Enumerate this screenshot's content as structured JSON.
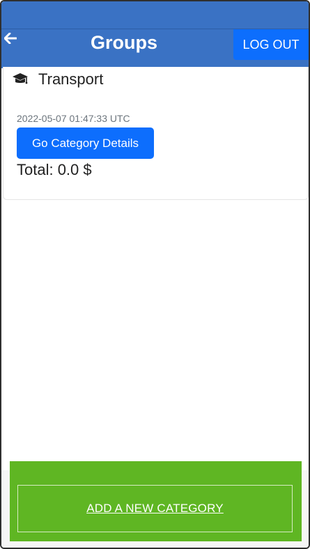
{
  "header": {
    "title": "Groups",
    "back_icon": "arrow-left-icon",
    "logout_label": "LOG OUT"
  },
  "categories": [
    {
      "icon": "graduation-cap-icon",
      "name": "Transport",
      "timestamp": "2022-05-07 01:47:33 UTC",
      "details_label": "Go Category Details",
      "total": "Total: 0.0 $"
    }
  ],
  "footer": {
    "add_label": "ADD A NEW CATEGORY"
  },
  "colors": {
    "header_bg": "#3a72c4",
    "primary_button": "#0d6efd",
    "add_button": "#5fb623"
  }
}
